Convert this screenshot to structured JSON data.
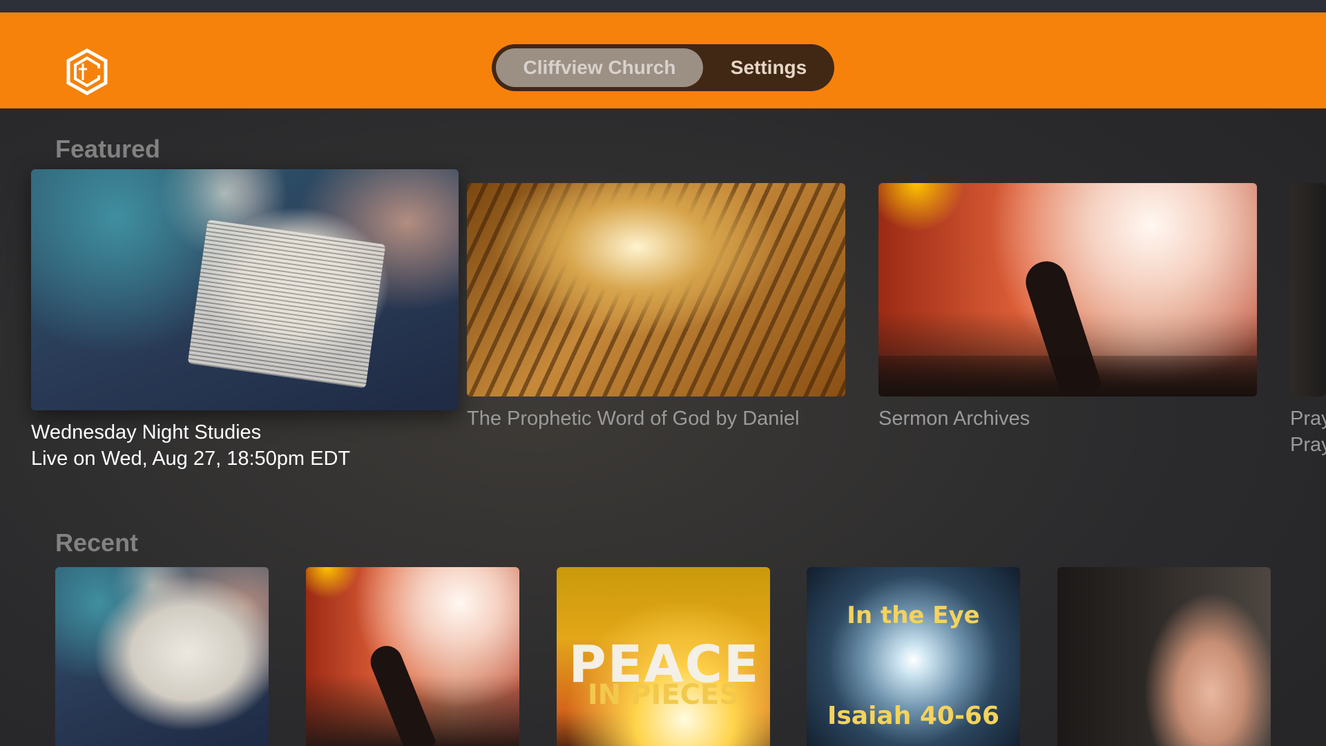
{
  "header": {
    "tabs": [
      {
        "label": "Cliffview Church",
        "selected": true
      },
      {
        "label": "Settings",
        "selected": false
      }
    ],
    "accent_color": "#f6820b"
  },
  "featured": {
    "title": "Featured",
    "items": [
      {
        "title": "Wednesday Night Studies",
        "subtitle": "Live on Wed, Aug 27, 18:50pm EDT",
        "focused": true
      },
      {
        "title": "The Prophetic Word of God by Daniel",
        "focused": false
      },
      {
        "title": "Sermon Archives",
        "focused": false
      },
      {
        "title": "Pray",
        "subtitle": "Pray",
        "focused": false
      }
    ]
  },
  "recent": {
    "title": "Recent",
    "items": [
      {
        "art_text": ""
      },
      {
        "art_text": ""
      },
      {
        "art_text": [
          "PEACE",
          "IN PIECES"
        ]
      },
      {
        "art_text": [
          "In the Eye",
          "Isaiah 40-66"
        ]
      },
      {
        "art_text": ""
      }
    ]
  }
}
